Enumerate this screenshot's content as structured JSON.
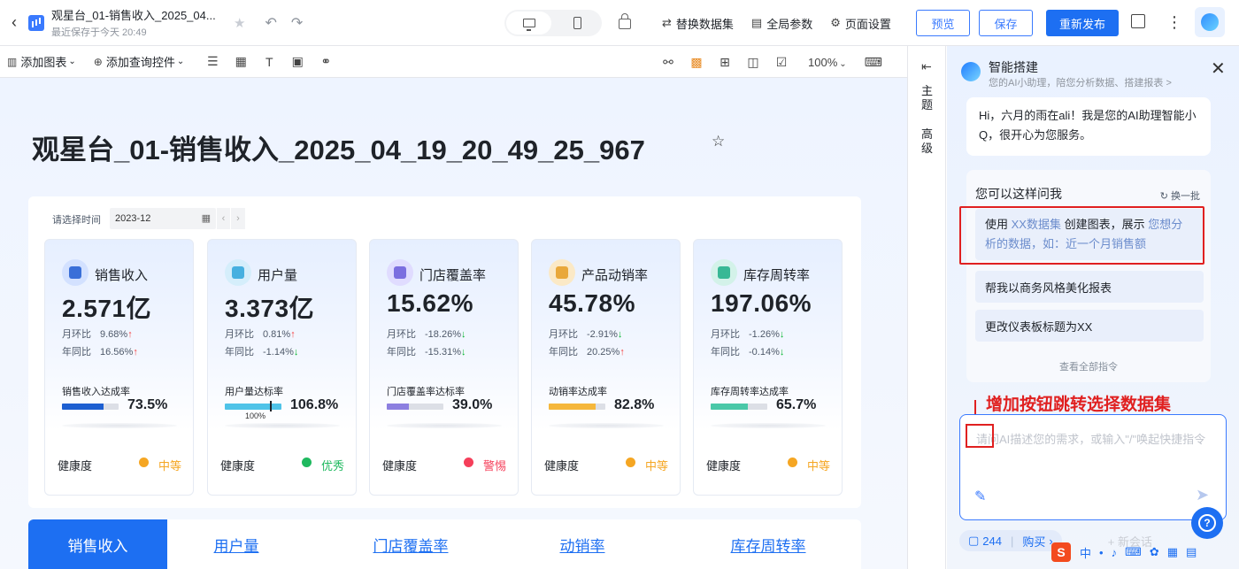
{
  "header": {
    "doc_title": "观星台_01-销售收入_2025_04...",
    "saved_text": "最近保存于今天 20:49",
    "actions": [
      "替换数据集",
      "全局参数",
      "页面设置"
    ],
    "preview_label": "预览",
    "save_label": "保存",
    "republish_label": "重新发布"
  },
  "toolbar": {
    "add_chart": "添加图表",
    "add_query": "添加查询控件",
    "zoom": "100%"
  },
  "dashboard": {
    "title": "观星台_01-销售收入_2025_04_19_20_49_25_967",
    "date_label": "请选择时间",
    "date_value": "2023-12",
    "cards": [
      {
        "name": "销售收入",
        "value": "2.571亿",
        "mom_label": "月环比",
        "mom": "9.68%",
        "mom_dir": "up",
        "yoy_label": "年同比",
        "yoy": "16.56%",
        "yoy_dir": "up",
        "rate_label": "销售收入达成率",
        "rate": "73.5%",
        "rate_fraction": 0.735,
        "bar_color": "#1d5fd1",
        "health_label": "健康度",
        "health": "中等",
        "health_color": "#f5a623",
        "icon_bg": "#d3e1ff",
        "icon_color": "#3a6fd8"
      },
      {
        "name": "用户量",
        "value": "3.373亿",
        "mom_label": "月环比",
        "mom": "0.81%",
        "mom_dir": "up",
        "yoy_label": "年同比",
        "yoy": "-1.14%",
        "yoy_dir": "down",
        "rate_label": "用户量达标率",
        "rate": "106.8%",
        "rate_fraction": 1.0,
        "marker_label": "100%",
        "bar_color": "#4fc3e8",
        "health_label": "健康度",
        "health": "优秀",
        "health_color": "#1fb95f",
        "icon_bg": "#d5eefb",
        "icon_color": "#46b0e0"
      },
      {
        "name": "门店覆盖率",
        "value": "15.62%",
        "mom_label": "月环比",
        "mom": "-18.26%",
        "mom_dir": "down",
        "yoy_label": "年同比",
        "yoy": "-15.31%",
        "yoy_dir": "down",
        "rate_label": "门店覆盖率达标率",
        "rate": "39.0%",
        "rate_fraction": 0.39,
        "bar_color": "#8c7fe0",
        "health_label": "健康度",
        "health": "警惕",
        "health_color": "#f53f5a",
        "icon_bg": "#e0dcff",
        "icon_color": "#7b6ee0"
      },
      {
        "name": "产品动销率",
        "value": "45.78%",
        "mom_label": "月环比",
        "mom": "-2.91%",
        "mom_dir": "down",
        "yoy_label": "年同比",
        "yoy": "20.25%",
        "yoy_dir": "up",
        "rate_label": "动销率达成率",
        "rate": "82.8%",
        "rate_fraction": 0.828,
        "bar_color": "#f5b73b",
        "health_label": "健康度",
        "health": "中等",
        "health_color": "#f5a623",
        "icon_bg": "#fbe9c6",
        "icon_color": "#e9a83a"
      },
      {
        "name": "库存周转率",
        "value": "197.06%",
        "mom_label": "月环比",
        "mom": "-1.26%",
        "mom_dir": "down",
        "yoy_label": "年同比",
        "yoy": "-0.14%",
        "yoy_dir": "down",
        "rate_label": "库存周转率达成率",
        "rate": "65.7%",
        "rate_fraction": 0.657,
        "bar_color": "#4ac8a8",
        "health_label": "健康度",
        "health": "中等",
        "health_color": "#f5a623",
        "icon_bg": "#d3f2e9",
        "icon_color": "#38b895"
      }
    ],
    "tabs": [
      "销售收入",
      "用户量",
      "门店覆盖率",
      "动销率",
      "库存周转率"
    ]
  },
  "rail": {
    "theme": "主题",
    "advanced": "高级"
  },
  "ai": {
    "title": "智能搭建",
    "subtitle": "您的AI小助理，陪您分析数据、搭建报表 >",
    "greeting": "Hi，六月的雨在ali！我是您的AI助理智能小Q，很开心为您服务。",
    "suggest_title": "您可以这样问我",
    "refresh": "换一批",
    "suggestion_1": {
      "p1": "使用 ",
      "p2": "XX数据集",
      "p3": " 创建图表，展示 ",
      "p4": "您想分析的数据，如：近一个月销售额"
    },
    "suggestion_2": "帮我以商务风格美化报表",
    "suggestion_3": "更改仪表板标题为XX",
    "view_all": "查看全部指令",
    "annotation": "增加按钮跳转选择数据集",
    "input_placeholder": "请问AI描述您的需求，或输入\"/\"唤起快捷指令",
    "count": "244",
    "buy": "购买",
    "new_chat": "+ 新会话"
  },
  "ime": {
    "logo": "S",
    "lang": "中"
  }
}
